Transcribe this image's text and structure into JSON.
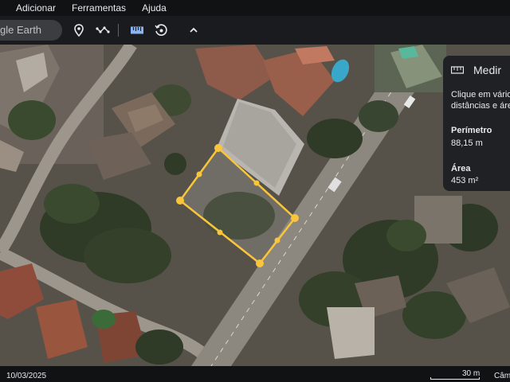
{
  "menu": {
    "items": [
      "Adicionar",
      "Ferramentas",
      "Ajuda"
    ]
  },
  "toolbar": {
    "search_placeholder": "Pesquisar no Google Earth",
    "search_visible": "gle Earth",
    "icons": [
      "place-mark-icon",
      "path-icon",
      "ruler-icon",
      "history-icon",
      "collapse-icon"
    ]
  },
  "measure": {
    "title": "Medir",
    "instruction_line1": "Clique em vário",
    "instruction_line2": "distâncias e áre",
    "perimeter_label": "Perímetro",
    "perimeter_value": "88,15 m",
    "area_label": "Área",
    "area_value": "453 m²"
  },
  "status": {
    "date": "10/03/2025",
    "scale": "30 m",
    "camera": "Câme"
  },
  "colors": {
    "polygon": "#f9c53b",
    "panel_bg": "#202124",
    "menubar_bg": "#111214"
  }
}
